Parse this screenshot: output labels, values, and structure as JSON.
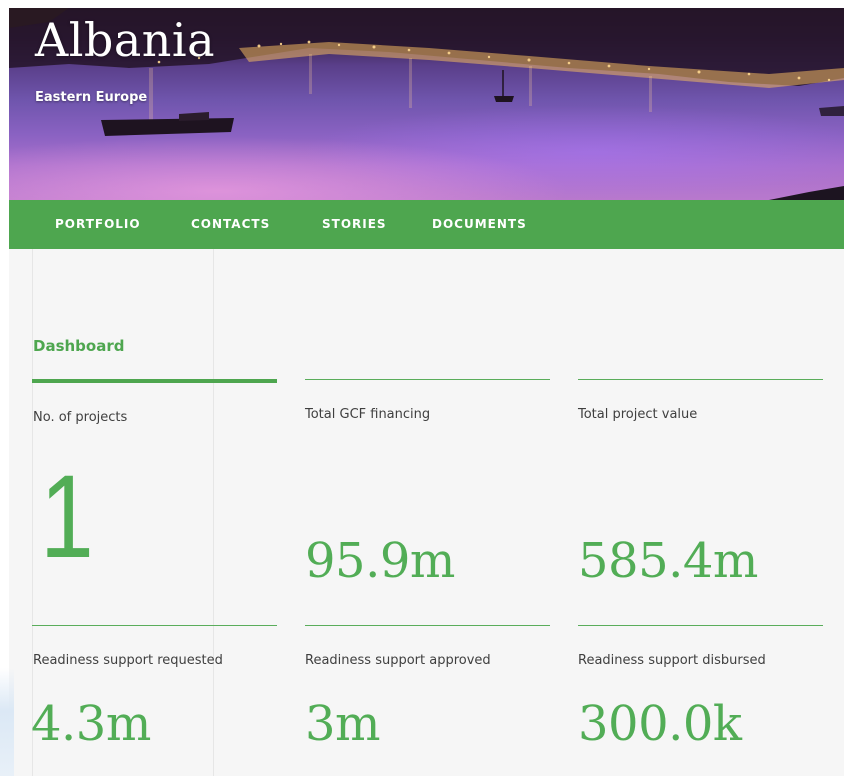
{
  "hero": {
    "title": "Albania",
    "subtitle": "Eastern Europe"
  },
  "nav": {
    "items": [
      {
        "label": "PORTFOLIO"
      },
      {
        "label": "CONTACTS"
      },
      {
        "label": "STORIES"
      },
      {
        "label": "DOCUMENTS"
      }
    ]
  },
  "dashboard": {
    "heading": "Dashboard",
    "stats": [
      {
        "label": "No. of projects",
        "value": "1"
      },
      {
        "label": "Total GCF financing",
        "value": "95.9m"
      },
      {
        "label": "Total project value",
        "value": "585.4m"
      },
      {
        "label": "Readiness support requested",
        "value": "4.3m"
      },
      {
        "label": "Readiness support approved",
        "value": "3m"
      },
      {
        "label": "Readiness support disbursed",
        "value": "300.0k"
      }
    ]
  },
  "colors": {
    "brand_green": "#4ea64f",
    "value_green": "#52ad56",
    "content_background": "#f6f6f6"
  }
}
